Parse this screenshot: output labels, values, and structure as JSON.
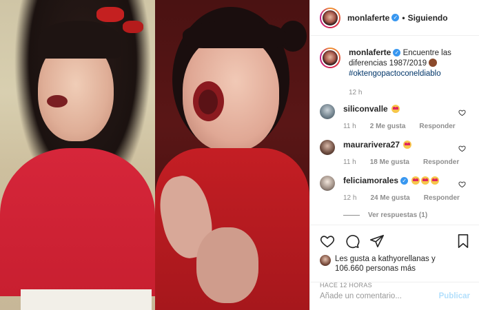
{
  "post": {
    "author": "monlaferte",
    "follow_status": "Siguiendo",
    "caption_user": "monlaferte",
    "caption_text": "Encuentre las diferencias 1987/2019",
    "caption_hashtag": "#oktengopactoconeldiablo",
    "caption_time": "12 h"
  },
  "comments": [
    {
      "user": "siliconvalle",
      "time": "11 h",
      "likes": "2 Me gusta",
      "reply": "Responder",
      "verified": false
    },
    {
      "user": "maurarivera27",
      "time": "11 h",
      "likes": "18 Me gusta",
      "reply": "Responder",
      "verified": false
    },
    {
      "user": "feliciamorales",
      "time": "12 h",
      "likes": "24 Me gusta",
      "reply": "Responder",
      "verified": true,
      "view_replies": "Ver respuestas (1)"
    }
  ],
  "likes_text": "Les gusta a kathyorellanas y",
  "likes_count": "106.660 personas más",
  "post_age": "HACE 12 HORAS",
  "comment_input": {
    "placeholder": "Añade un comentario...",
    "publish": "Publicar"
  },
  "colors": {
    "link": "#003569",
    "verified": "#3897f0",
    "publish_disabled": "#b2dffc",
    "meta_gray": "#8e8e8e"
  },
  "icons": [
    "verified-badge-icon",
    "heart-icon",
    "comment-icon",
    "share-icon",
    "bookmark-icon",
    "heart-eyes-emoji"
  ]
}
